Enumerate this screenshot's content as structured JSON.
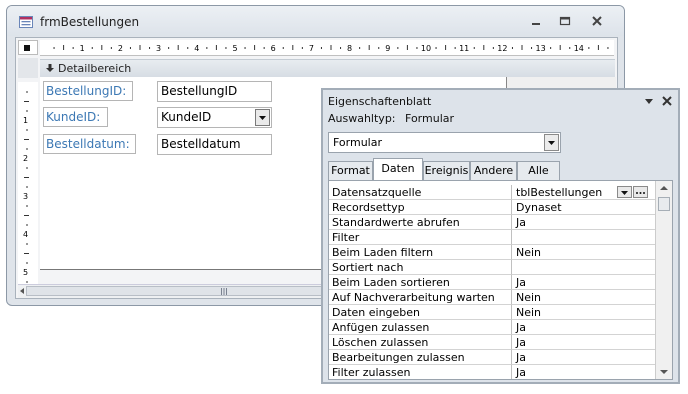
{
  "form_window": {
    "title": "frmBestellungen",
    "section_label": "Detailbereich",
    "ruler_numbers": [
      "1",
      "2",
      "3",
      "4",
      "5",
      "6",
      "7",
      "8",
      "9",
      "10",
      "11",
      "12",
      "13",
      "14"
    ],
    "vruler_numbers": [
      "1",
      "2",
      "3",
      "4",
      "5"
    ],
    "controls": [
      {
        "label": "BestellungID:",
        "value": "BestellungID",
        "type": "text"
      },
      {
        "label": "KundeID:",
        "value": "KundeID",
        "type": "combo"
      },
      {
        "label": "Bestelldatum:",
        "value": "Bestelldatum",
        "type": "text"
      }
    ]
  },
  "property_sheet": {
    "title": "Eigenschaftenblatt",
    "selection_type_label": "Auswahltyp:",
    "selection_type_value": "Formular",
    "object_combo": "Formular",
    "tabs": [
      "Format",
      "Daten",
      "Ereignis",
      "Andere",
      "Alle"
    ],
    "active_tab": "Daten",
    "rows": [
      {
        "name": "Datensatzquelle",
        "value": "tblBestellungen"
      },
      {
        "name": "Recordsettyp",
        "value": "Dynaset"
      },
      {
        "name": "Standardwerte abrufen",
        "value": "Ja"
      },
      {
        "name": "Filter",
        "value": ""
      },
      {
        "name": "Beim Laden filtern",
        "value": "Nein"
      },
      {
        "name": "Sortiert nach",
        "value": ""
      },
      {
        "name": "Beim Laden sortieren",
        "value": "Ja"
      },
      {
        "name": "Auf Nachverarbeitung warten",
        "value": "Nein"
      },
      {
        "name": "Daten eingeben",
        "value": "Nein"
      },
      {
        "name": "Anfügen zulassen",
        "value": "Ja"
      },
      {
        "name": "Löschen zulassen",
        "value": "Ja"
      },
      {
        "name": "Bearbeitungen zulassen",
        "value": "Ja"
      },
      {
        "name": "Filter zulassen",
        "value": "Ja"
      }
    ]
  },
  "colors": {
    "label_text": "#3c78b4",
    "window_frame": "#dfe4ea"
  }
}
